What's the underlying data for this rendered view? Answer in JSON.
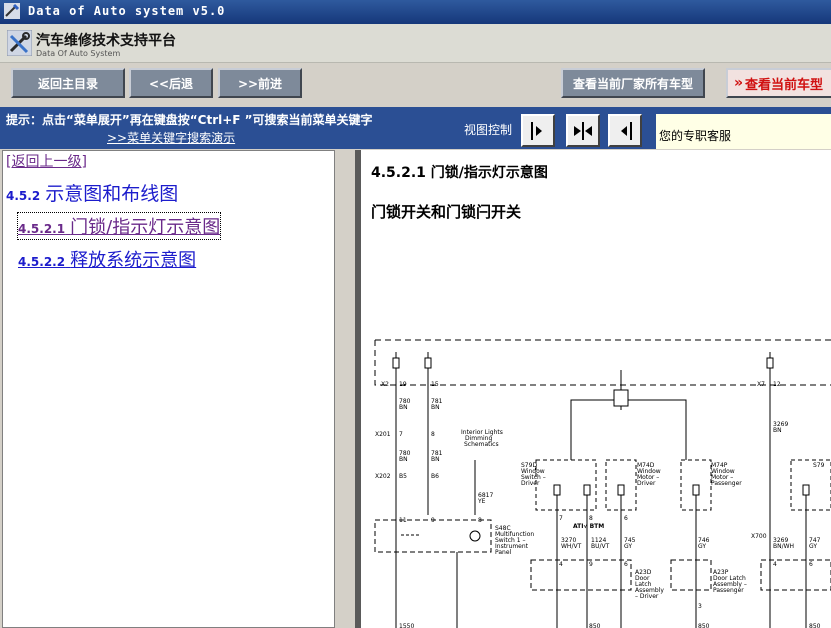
{
  "window": {
    "title": "Data of Auto system v5.0",
    "icon": "app-icon"
  },
  "header": {
    "name": "汽车维修技术支持平台",
    "subtitle": "Data Of Auto System"
  },
  "toolbar": {
    "home_label": "返回主目录",
    "back_label": "<<后退",
    "forward_label": ">>前进",
    "all_models_label": "查看当前厂家所有车型",
    "current_model_label": "查看当前车型"
  },
  "hintbar": {
    "hint": "提示：点击“菜单展开”再在键盘按“Ctrl+F ”可搜索当前菜单关键字",
    "demo_link": ">>菜单关键字搜索演示",
    "view_label": "视图控制",
    "service_text": "您的专职客服"
  },
  "nav": {
    "back_up": "[返回上一级]",
    "section": {
      "num": "4.5.2",
      "title": "示意图和布线图"
    },
    "items": [
      {
        "num": "4.5.2.1",
        "title": "门锁/指示灯示意图"
      },
      {
        "num": "4.5.2.2",
        "title": "释放系统示意图"
      }
    ]
  },
  "content": {
    "title": "4.5.2.1 门锁/指示灯示意图",
    "subtitle": "门锁开关和门锁闩开关"
  },
  "diagram": {
    "connectors": [
      "X2",
      "19",
      "15",
      "X7",
      "12"
    ],
    "wires": [
      "780",
      "BN",
      "781",
      "BN",
      "X201",
      "7",
      "8",
      "X202",
      "B5",
      "B6",
      "11",
      "9",
      "3269",
      "BN",
      "BN/WH",
      "747",
      "GY",
      "X700"
    ],
    "labels": [
      "Interior Lights",
      "Dimming",
      "Schematics",
      "S79D",
      "Window",
      "Switch –",
      "Driver",
      "M74D",
      "Window",
      "Motor –",
      "Driver",
      "M74P",
      "Window",
      "Motor –",
      "Passenger",
      "S79",
      "Win",
      "Swi",
      "Left",
      "6817",
      "YE",
      "8",
      "S48C",
      "Multifunction",
      "Switch 1 –",
      "Instrument",
      "Panel",
      "7",
      "ATI√ BTM",
      "3270",
      "1124",
      "WH/VT",
      "BU/VT",
      "6",
      "745",
      "GY",
      "746",
      "GY",
      "4",
      "6",
      "A23D",
      "Door",
      "Latch",
      "Assembly",
      "– Driver",
      "3",
      "A23P",
      "Door Latch",
      "Assembly –",
      "Passenger",
      "A23L",
      "Door",
      "Latc",
      "Asse",
      "– Lef",
      "Rear",
      "1550",
      "850",
      "850",
      "850"
    ]
  }
}
